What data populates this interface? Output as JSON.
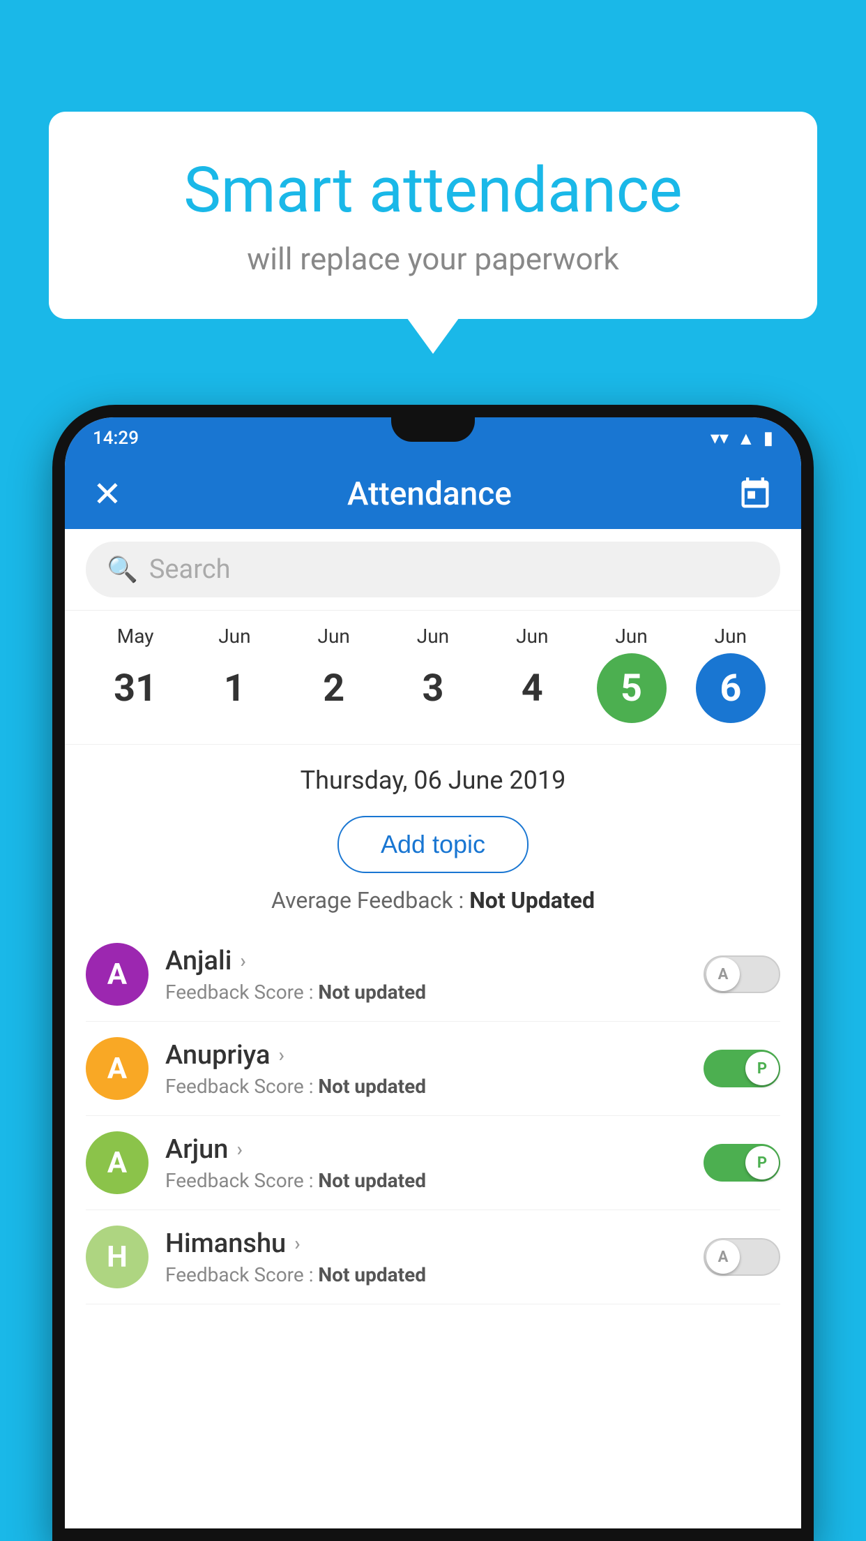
{
  "background_color": "#1ab8e8",
  "speech_bubble": {
    "title": "Smart attendance",
    "subtitle": "will replace your paperwork"
  },
  "status_bar": {
    "time": "14:29",
    "icons": [
      "wifi",
      "signal",
      "battery"
    ]
  },
  "header": {
    "title": "Attendance",
    "close_label": "✕",
    "calendar_icon": "calendar-icon"
  },
  "search": {
    "placeholder": "Search"
  },
  "calendar": {
    "items": [
      {
        "month": "May",
        "date": "31",
        "state": "normal"
      },
      {
        "month": "Jun",
        "date": "1",
        "state": "normal"
      },
      {
        "month": "Jun",
        "date": "2",
        "state": "normal"
      },
      {
        "month": "Jun",
        "date": "3",
        "state": "normal"
      },
      {
        "month": "Jun",
        "date": "4",
        "state": "normal"
      },
      {
        "month": "Jun",
        "date": "5",
        "state": "today"
      },
      {
        "month": "Jun",
        "date": "6",
        "state": "selected"
      }
    ]
  },
  "selected_date": "Thursday, 06 June 2019",
  "add_topic_label": "Add topic",
  "average_feedback": {
    "label": "Average Feedback : ",
    "value": "Not Updated"
  },
  "students": [
    {
      "name": "Anjali",
      "avatar_letter": "A",
      "avatar_color": "purple",
      "feedback_label": "Feedback Score : ",
      "feedback_value": "Not updated",
      "toggle_state": "off",
      "toggle_label": "A"
    },
    {
      "name": "Anupriya",
      "avatar_letter": "A",
      "avatar_color": "yellow",
      "feedback_label": "Feedback Score : ",
      "feedback_value": "Not updated",
      "toggle_state": "on",
      "toggle_label": "P"
    },
    {
      "name": "Arjun",
      "avatar_letter": "A",
      "avatar_color": "green",
      "feedback_label": "Feedback Score : ",
      "feedback_value": "Not updated",
      "toggle_state": "on",
      "toggle_label": "P"
    },
    {
      "name": "Himanshu",
      "avatar_letter": "H",
      "avatar_color": "light-green",
      "feedback_label": "Feedback Score : ",
      "feedback_value": "Not updated",
      "toggle_state": "off",
      "toggle_label": "A"
    }
  ]
}
